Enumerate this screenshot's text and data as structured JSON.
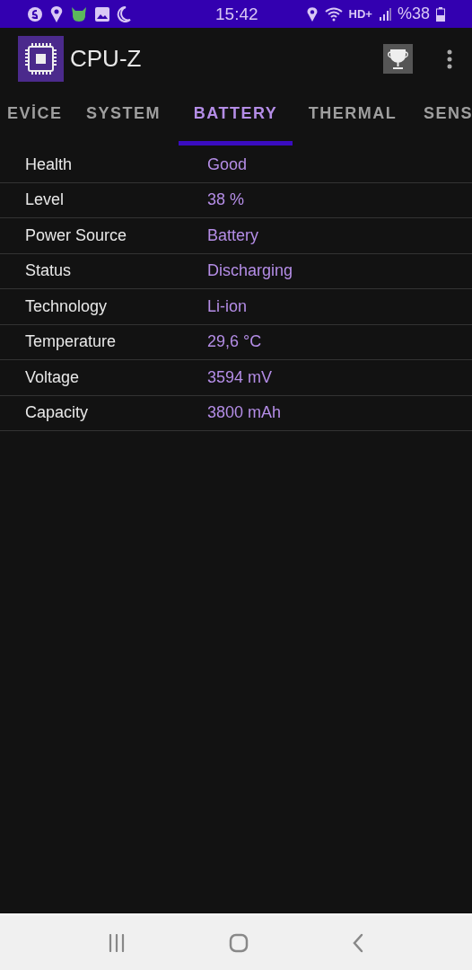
{
  "status_bar": {
    "time": "15:42",
    "network": "HD+",
    "battery": "%38"
  },
  "app_bar": {
    "title": "CPU-Z"
  },
  "tabs": [
    {
      "label": "EVİCE",
      "selected": false
    },
    {
      "label": "SYSTEM",
      "selected": false
    },
    {
      "label": "BATTERY",
      "selected": true
    },
    {
      "label": "THERMAL",
      "selected": false
    },
    {
      "label": "SENS",
      "selected": false
    }
  ],
  "rows": [
    {
      "label": "Health",
      "value": "Good"
    },
    {
      "label": "Level",
      "value": "38 %"
    },
    {
      "label": "Power Source",
      "value": "Battery"
    },
    {
      "label": "Status",
      "value": "Discharging"
    },
    {
      "label": "Technology",
      "value": "Li-ion"
    },
    {
      "label": "Temperature",
      "value": "29,6 °C"
    },
    {
      "label": "Voltage",
      "value": "3594 mV"
    },
    {
      "label": "Capacity",
      "value": "3800 mAh"
    }
  ]
}
